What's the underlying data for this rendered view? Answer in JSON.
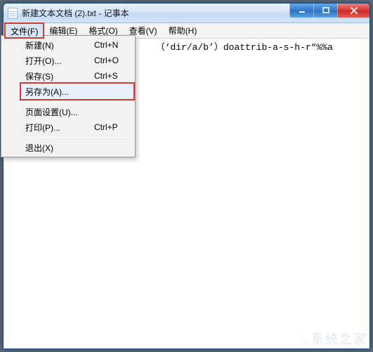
{
  "window": {
    "title": "新建文本文档 (2).txt - 记事本"
  },
  "menubar": {
    "file": "文件(F)",
    "edit": "编辑(E)",
    "format": "格式(O)",
    "view": "查看(V)",
    "help": "帮助(H)"
  },
  "file_menu": {
    "new": {
      "label": "新建(N)",
      "shortcut": "Ctrl+N"
    },
    "open": {
      "label": "打开(O)...",
      "shortcut": "Ctrl+O"
    },
    "save": {
      "label": "保存(S)",
      "shortcut": "Ctrl+S"
    },
    "save_as": {
      "label": "另存为(A)...",
      "shortcut": ""
    },
    "page_setup": {
      "label": "页面设置(U)...",
      "shortcut": ""
    },
    "print": {
      "label": "打印(P)...",
      "shortcut": "Ctrl+P"
    },
    "exit": {
      "label": "退出(X)",
      "shortcut": ""
    }
  },
  "editor": {
    "visible_text": "（‘dir/a/b’）doattrib-a-s-h-r“%%a"
  },
  "watermark": "系统之家"
}
